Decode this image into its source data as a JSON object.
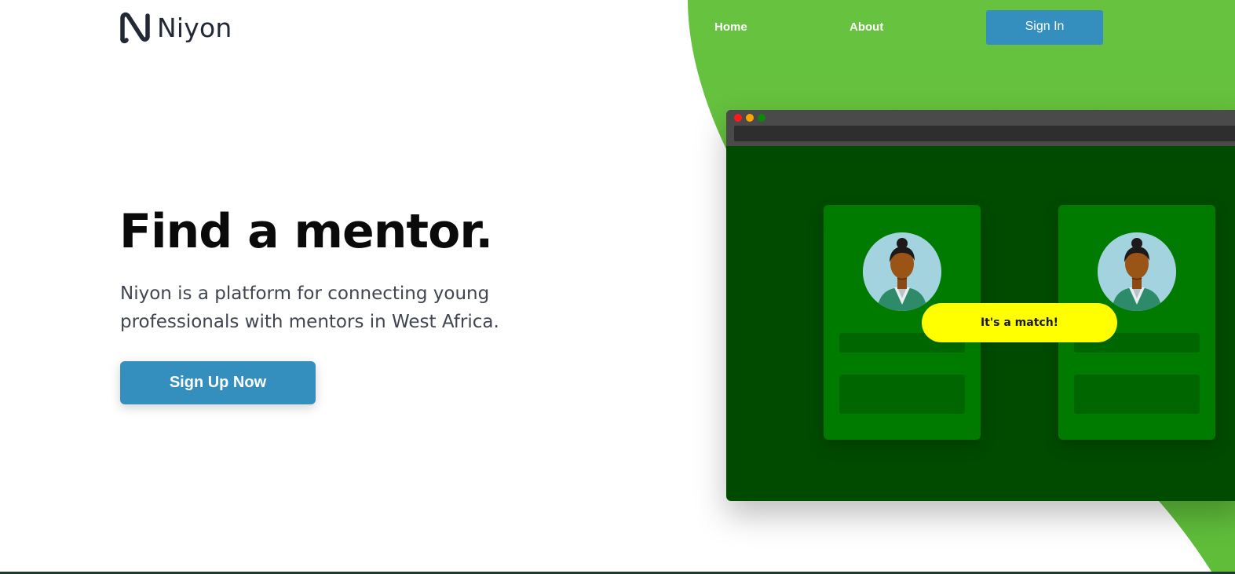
{
  "brand": {
    "name": "Niyon",
    "logo_icon": "niyon-n-icon",
    "text_color": "#232837"
  },
  "nav": {
    "home_label": "Home",
    "about_label": "About",
    "signin_label": "Sign In"
  },
  "hero": {
    "title": "Find a mentor.",
    "subtitle": "Niyon is a platform for connecting young professionals with mentors in West Africa.",
    "cta_label": "Sign Up Now"
  },
  "mockup": {
    "match_label": "It's a match!",
    "window_dots": [
      "red",
      "yellow",
      "green"
    ],
    "avatar_icon": "mentor-avatar-icon"
  },
  "colors": {
    "accent_blue": "#358fbe",
    "blob_green": "#66c23f",
    "screen_green": "#004b00",
    "card_green": "#007b00",
    "match_yellow": "#ffff00"
  }
}
